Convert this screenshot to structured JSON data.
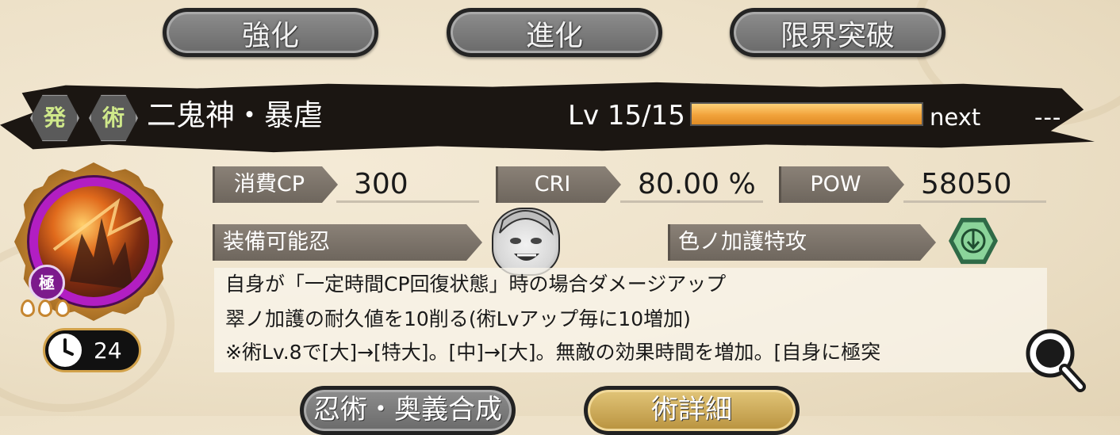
{
  "tabs": {
    "enhance": "強化",
    "evolve": "進化",
    "limit_break": "限界突破"
  },
  "header": {
    "title": "二鬼神・暴虐",
    "seal1": "発",
    "seal2": "術",
    "level_label": "Lv 15/15",
    "exp_progress": 1.0,
    "next_label": "next",
    "next_value": "---"
  },
  "stats": {
    "cp_label": "消費CP",
    "cp_value": "300",
    "cri_label": "CRI",
    "cri_value": "80.00 %",
    "pow_label": "POW",
    "pow_value": "58050"
  },
  "equip": {
    "label": "装備可能忍",
    "bonus_label": "色ノ加護特攻"
  },
  "description": {
    "line1": "自身が「一定時間CP回復状態」時の場合ダメージアップ",
    "line2": "翠ノ加護の耐久値を10削る(術Lvアップ毎に10増加)",
    "line3": "※術Lv.8で[大]→[特大]。[中]→[大]。無敵の効果時間を増加。[自身に極突"
  },
  "medal": {
    "rank": "極",
    "cooldown": "24"
  },
  "bottom": {
    "fusion": "忍術・奥義合成",
    "detail": "術詳細"
  },
  "colors": {
    "exp_bar": "#f1a23b",
    "medal_ring": "#b21ec2",
    "attribute_green": "#8bd49a",
    "tab_gray": "#7a7a7a",
    "detail_gold": "#c8a44e"
  }
}
